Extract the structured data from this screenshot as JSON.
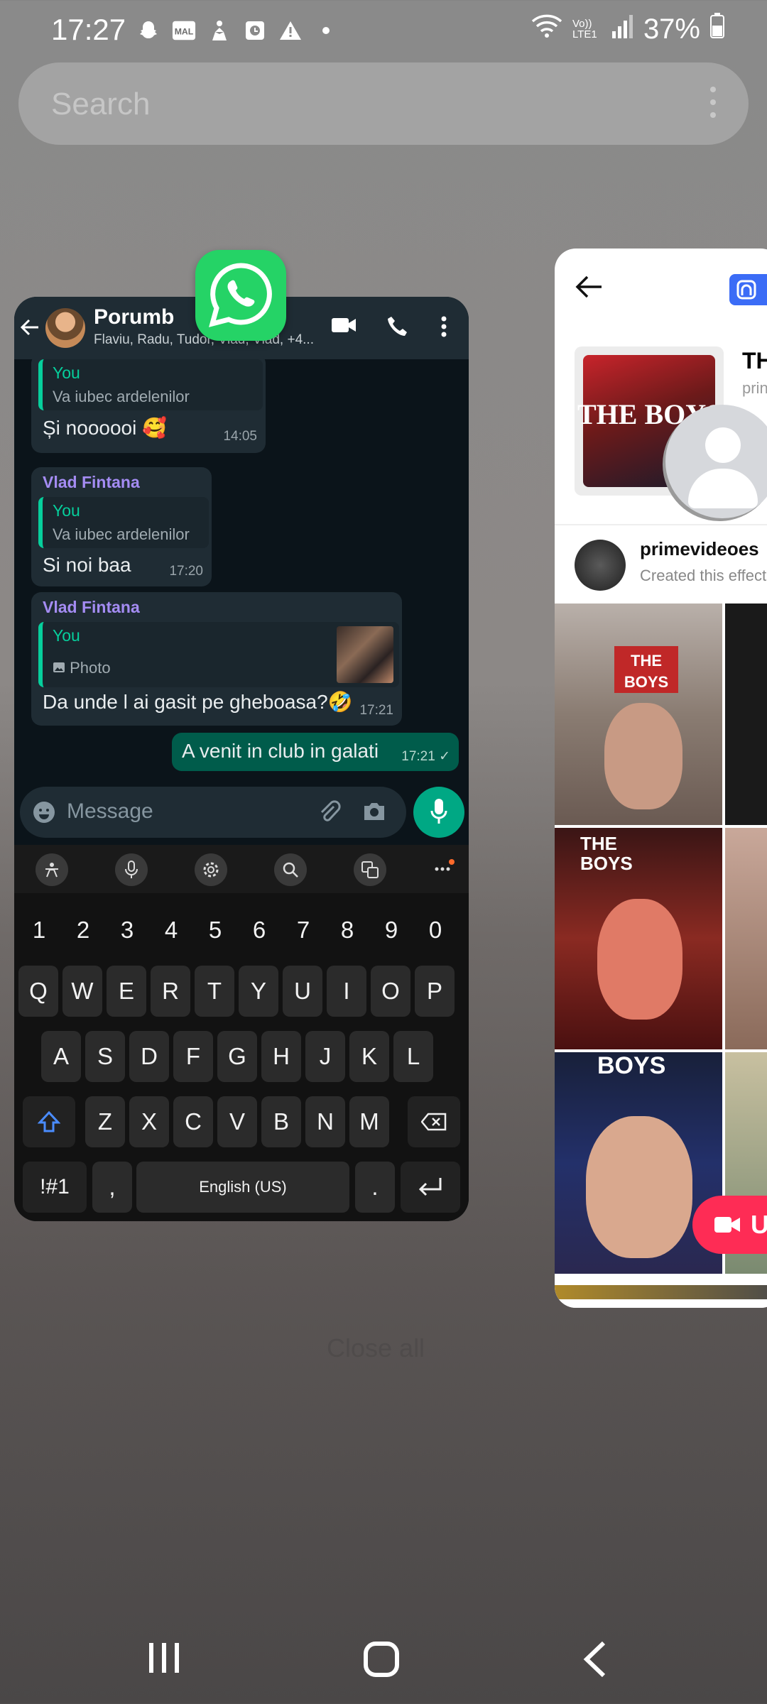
{
  "status_bar": {
    "time": "17:27",
    "notification_icons": [
      "snapchat-icon",
      "mal-icon",
      "hand-icon",
      "calendar-icon",
      "warning-icon",
      "dot-icon"
    ],
    "right_icons": [
      "wifi-icon",
      "volte-icon",
      "signal-icon"
    ],
    "volte_label": "Vo)) LTE1",
    "battery": "37%"
  },
  "search": {
    "placeholder": "Search"
  },
  "whatsapp": {
    "chat_name": "Porumb",
    "members": "Flaviu, Radu, Tudor, Vlad, Vlad, +4...",
    "messages": [
      {
        "quote_author": "You",
        "quote_text": "Va iubec ardelenilor",
        "text": "Și noooooi 🥰",
        "time": "14:05"
      },
      {
        "sender": "Vlad Fintana",
        "quote_author": "You",
        "quote_text": "Va iubec ardelenilor",
        "text": "Si noi baa",
        "time": "17:20"
      },
      {
        "sender": "Vlad Fintana",
        "quote_author": "You",
        "quote_text": "Photo",
        "text": "Da unde l ai gasit pe gheboasa?🤣",
        "time": "17:21"
      },
      {
        "text": "A venit in club in galati",
        "time": "17:21 ✓"
      }
    ],
    "input_placeholder": "Message",
    "colors": {
      "header": "#1f2c34",
      "accent": "#00a884",
      "outgoing": "#005c4b",
      "sender": "#a48cf3"
    }
  },
  "keyboard": {
    "row_numbers": [
      "1",
      "2",
      "3",
      "4",
      "5",
      "6",
      "7",
      "8",
      "9",
      "0"
    ],
    "row1": [
      "Q",
      "W",
      "E",
      "R",
      "T",
      "Y",
      "U",
      "I",
      "O",
      "P"
    ],
    "row2": [
      "A",
      "S",
      "D",
      "F",
      "G",
      "H",
      "J",
      "K",
      "L"
    ],
    "row3": [
      "Z",
      "X",
      "C",
      "V",
      "B",
      "N",
      "M"
    ],
    "sym_key": "!#1",
    "comma": ",",
    "space": "English (US)",
    "period": ".",
    "toolbar_icons": [
      "sticker-icon",
      "voice-icon",
      "settings-icon",
      "search-icon",
      "translate-icon",
      "more-icon"
    ]
  },
  "effect_app": {
    "title": "TH",
    "subtitle": "prin",
    "poster_logo": "THE BOYS",
    "creator_name": "primevideoes",
    "creator_sub": "Created this effect",
    "grid_labels": [
      "THE BOYS",
      "THE BOYS",
      "BOYS"
    ],
    "record_button": "U",
    "colors": {
      "record": "#fe2c55",
      "badge": "#3b6cf6"
    }
  },
  "background_text": "Close all",
  "nav_bar": {
    "icons": [
      "recents-icon",
      "home-icon",
      "back-icon"
    ]
  }
}
